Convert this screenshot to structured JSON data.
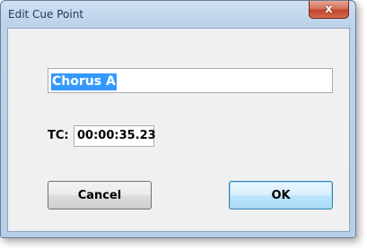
{
  "window": {
    "title": "Edit Cue Point",
    "close_glyph": "x"
  },
  "form": {
    "name_value": "Chorus A",
    "tc_label": "TC:",
    "tc_value": "00:00:35.23"
  },
  "buttons": {
    "cancel_label": "Cancel",
    "ok_label": "OK"
  },
  "colors": {
    "selection": "#3399ff",
    "close_button": "#c2442b",
    "default_button_border": "#3c7fb1"
  }
}
